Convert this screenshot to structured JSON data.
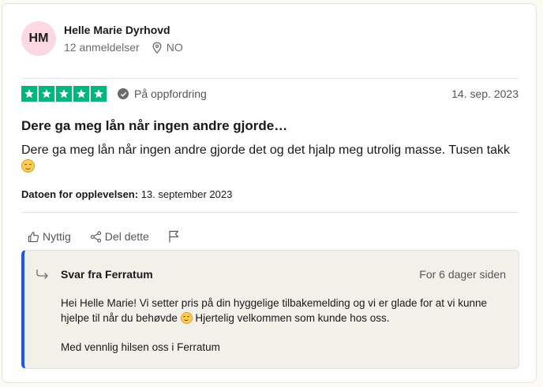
{
  "reviewer": {
    "initials": "HM",
    "name": "Helle Marie Dyrhovd",
    "review_count": "12 anmeldelser",
    "country": "NO"
  },
  "review": {
    "rating": 5,
    "rating_color": "#00b67a",
    "verified_label": "På oppfordring",
    "date": "14. sep. 2023",
    "title": "Dere ga meg lån når ingen andre gjorde…",
    "body": "Dere ga meg lån når ingen andre gjorde det og det hjalp meg utrolig masse. Tusen takk",
    "experience_label": "Datoen for opplevelsen:",
    "experience_date": "13. september 2023"
  },
  "actions": {
    "useful_label": "Nyttig",
    "share_label": "Del dette",
    "icons": [
      "thumbs-up-icon",
      "share-icon",
      "flag-icon"
    ]
  },
  "reply": {
    "from": "Svar fra Ferratum",
    "time": "For 6 dager siden",
    "text_before_emoji": "Hei Helle Marie! Vi setter pris på din hyggelige tilbakemelding og vi er glade for at vi kunne hjelpe til når du behøvde",
    "text_after_emoji": "Hjertelig velkommen som kunde hos oss.",
    "signature": "Med vennlig hilsen oss i Ferratum",
    "accent_color": "#1c57e8"
  }
}
